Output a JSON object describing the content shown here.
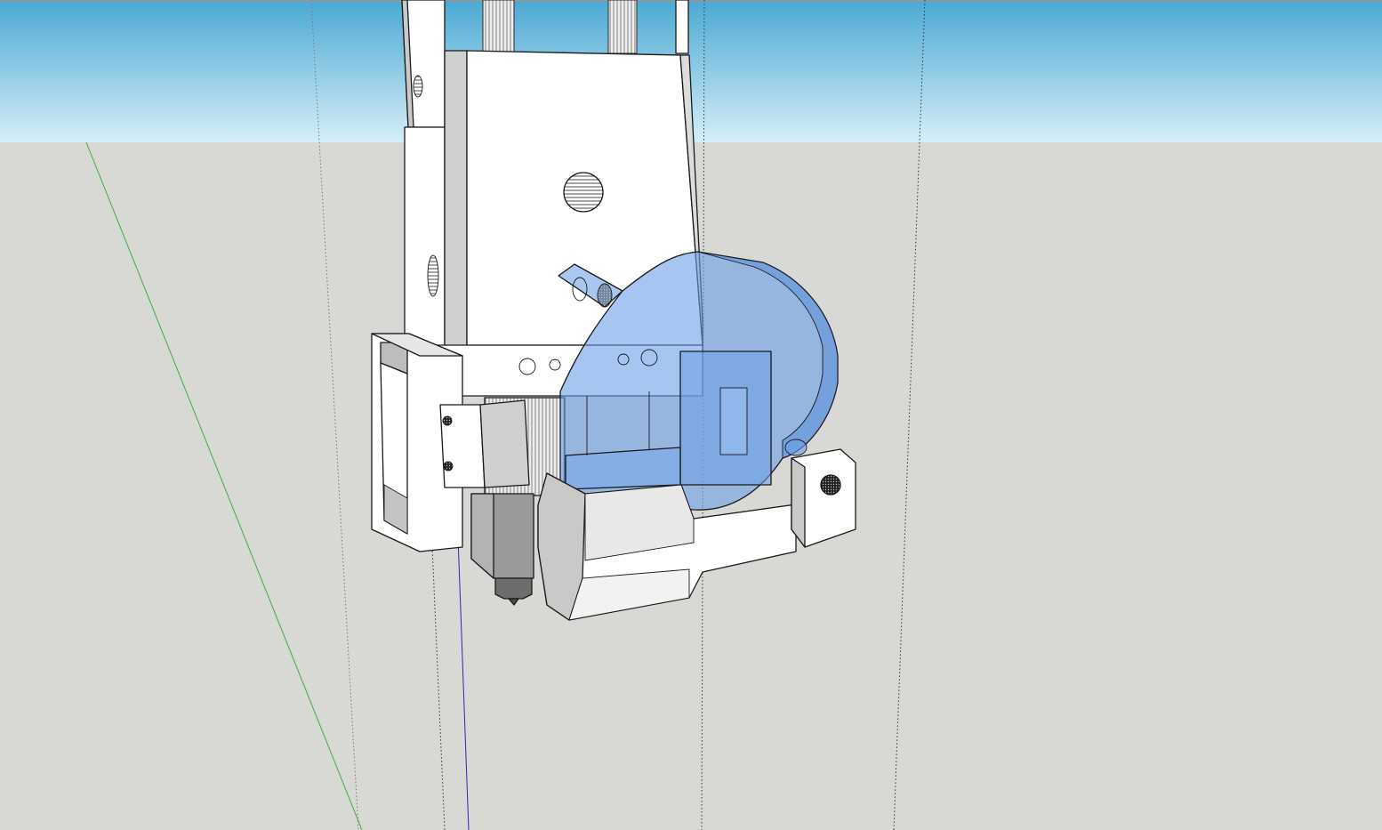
{
  "window": {
    "title": ""
  },
  "viewport": {
    "sky_top": "#4aa9d3",
    "sky_bottom": "#d6eef8",
    "ground": "#d8d8d4",
    "axis_colors": {
      "red": "#d23a2b",
      "green": "#3cb13c",
      "blue": "#2a2ab8"
    }
  },
  "model": {
    "face_color": "#ffffff",
    "shade_color": "#c7c7c7",
    "dark_shade": "#9c9c9c",
    "fan_duct_color": "#6b9fe6",
    "components": [
      "carriage-plate",
      "linear-rods",
      "hotend-heatsink",
      "nozzle",
      "fan-duct",
      "part-cooling-fan",
      "bottom-bracket",
      "side-bracket"
    ]
  }
}
